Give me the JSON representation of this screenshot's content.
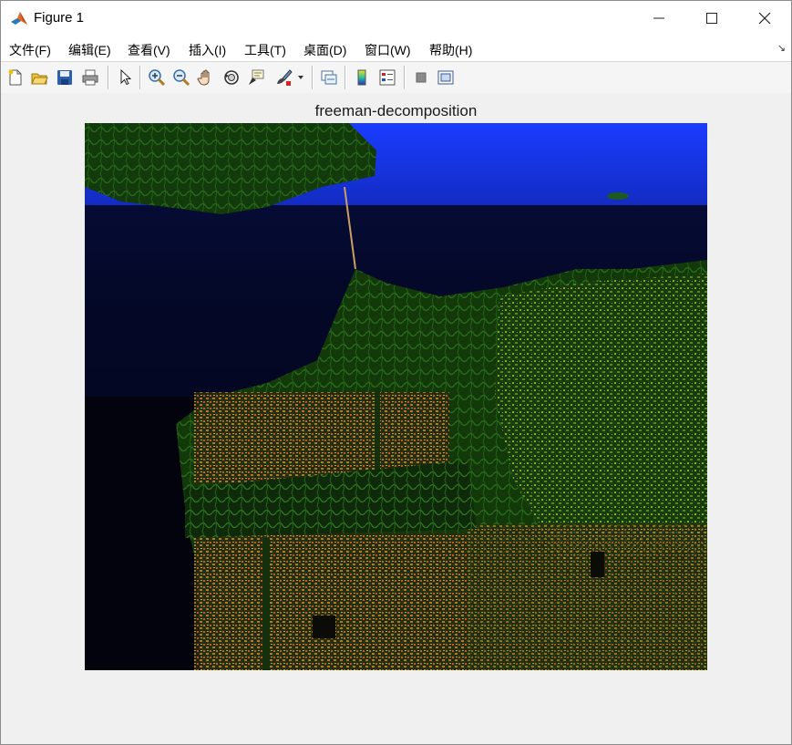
{
  "window": {
    "title": "Figure 1",
    "controls": [
      "minimize",
      "maximize",
      "close"
    ]
  },
  "menubar": {
    "items": [
      {
        "label": "文件(F)"
      },
      {
        "label": "编辑(E)"
      },
      {
        "label": "查看(V)"
      },
      {
        "label": "插入(I)"
      },
      {
        "label": "工具(T)"
      },
      {
        "label": "桌面(D)"
      },
      {
        "label": "窗口(W)"
      },
      {
        "label": "帮助(H)"
      }
    ]
  },
  "toolbar": {
    "icons": [
      "new-figure-icon",
      "open-file-icon",
      "save-icon",
      "print-icon",
      "edit-plot-icon",
      "zoom-in-icon",
      "zoom-out-icon",
      "pan-icon",
      "rotate-3d-icon",
      "data-cursor-icon",
      "brush-icon",
      "link-plot-icon",
      "insert-colorbar-icon",
      "insert-legend-icon",
      "hide-plot-tools-icon",
      "show-plot-tools-icon"
    ]
  },
  "figure": {
    "title": "freeman-decomposition",
    "image_description_colors": {
      "background": "#05050f",
      "water_top": "#1a3cff",
      "vegetation": "#1f7a14",
      "urban": "#c49a1a"
    }
  }
}
